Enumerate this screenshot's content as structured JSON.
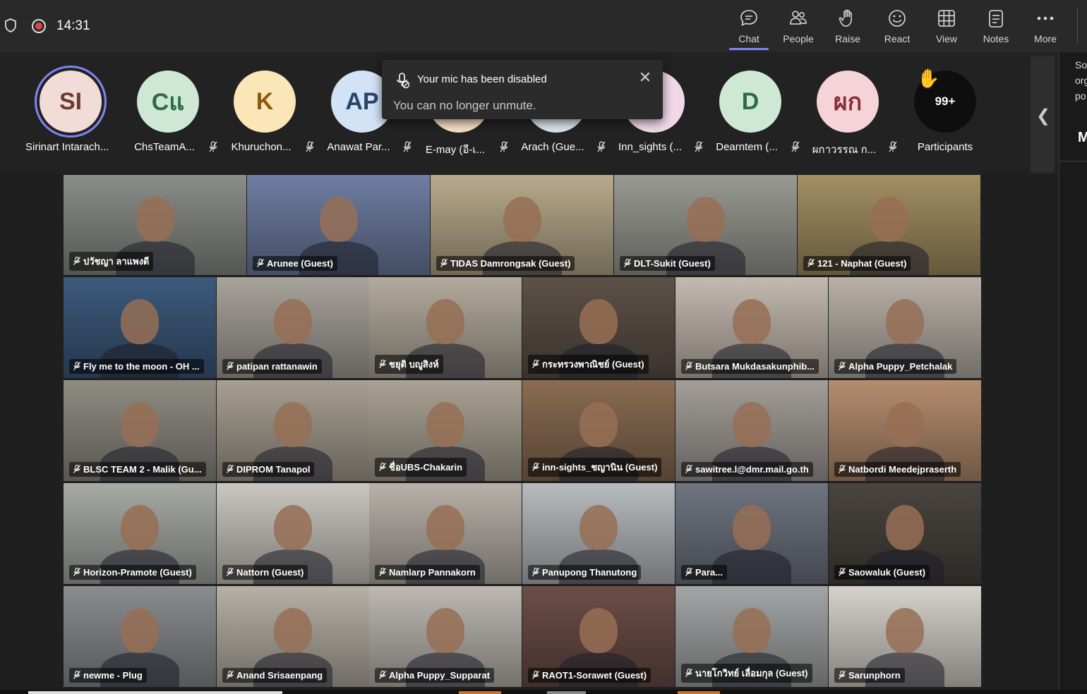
{
  "status": {
    "time": "14:31"
  },
  "toolbar": [
    {
      "key": "chat",
      "label": "Chat",
      "icon": "chat-icon"
    },
    {
      "key": "people",
      "label": "People",
      "icon": "people-icon"
    },
    {
      "key": "raise",
      "label": "Raise",
      "icon": "raise-hand-icon"
    },
    {
      "key": "react",
      "label": "React",
      "icon": "react-icon"
    },
    {
      "key": "view",
      "label": "View",
      "icon": "view-grid-icon"
    },
    {
      "key": "notes",
      "label": "Notes",
      "icon": "notes-icon"
    },
    {
      "key": "more",
      "label": "More",
      "icon": "more-icon"
    }
  ],
  "participants": [
    {
      "initials": "SI",
      "name": "Sirinart Intarach...",
      "bg": "#f1dcd8",
      "fg": "#6d3a33"
    },
    {
      "initials": "Cแ",
      "name": "ChsTeamA...",
      "bg": "#cfe8d6",
      "fg": "#2e6b45"
    },
    {
      "initials": "K",
      "name": "Khuruchon...",
      "bg": "#fbe6b8",
      "fg": "#8a5a10"
    },
    {
      "initials": "AP",
      "name": "Anawat Par...",
      "bg": "#d3e2f4",
      "fg": "#27456c"
    },
    {
      "initials": "",
      "name": "E-may (อี-เ...",
      "bg": "#f5dfc6",
      "fg": "#6d4a25"
    },
    {
      "initials": "",
      "name": "Arach (Gue...",
      "bg": "#d8e2ea",
      "fg": "#34495e"
    },
    {
      "initials": "",
      "name": "Inn_sights (...",
      "bg": "#f0d8e8",
      "fg": "#6a2f58"
    },
    {
      "initials": "D",
      "name": "Dearntem (...",
      "bg": "#cfe8d6",
      "fg": "#2e6b45"
    },
    {
      "initials": "ผก",
      "name": "ผกาวรรณ ก...",
      "bg": "#f6d3d8",
      "fg": "#8a2c3b"
    }
  ],
  "overflow": {
    "count": "99+",
    "label": "Participants"
  },
  "toast": {
    "title": "Your mic has been disabled",
    "message": "You can no longer unmute."
  },
  "right_panel": {
    "lines": [
      "So",
      "org",
      "po"
    ],
    "big": "M"
  },
  "tiles": [
    {
      "label": "ปวัชญา ลาแพงดี",
      "bg": "#8a8d88"
    },
    {
      "label": "Arunee (Guest)",
      "bg": "#6e7ea2"
    },
    {
      "label": "TIDAS Damrongsak (Guest)",
      "bg": "#b8aa8c"
    },
    {
      "label": "DLT-Sukit (Guest)",
      "bg": "#9a9a94"
    },
    {
      "label": "121 - Naphat (Guest)",
      "bg": "#a38f62"
    },
    {
      "label": "Fly me to the moon - OH ...",
      "bg": "#3c5a7c"
    },
    {
      "label": "patipan rattanawin",
      "bg": "#a8a39b"
    },
    {
      "label": "ชยุติ บญูสิงห์",
      "bg": "#b3ab9d"
    },
    {
      "label": "กระทรวงพาณิชย์ (Guest)",
      "bg": "#5d5148"
    },
    {
      "label": "Butsara Mukdasakunphib...",
      "bg": "#c4bab0"
    },
    {
      "label": "Alpha Puppy_Petchalak",
      "bg": "#b9b1a8"
    },
    {
      "label": "BLSC TEAM 2 - Malik (Gu...",
      "bg": "#8f8c83"
    },
    {
      "label": "DIPROM Tanapol",
      "bg": "#a79f92"
    },
    {
      "label": "ชื่อUBS-Chakarin",
      "bg": "#aaa394"
    },
    {
      "label": "inn-sights_ชญานิน (Guest)",
      "bg": "#8a6c52"
    },
    {
      "label": "sawitree.l@dmr.mail.go.th",
      "bg": "#a39e99"
    },
    {
      "label": "Natbordi Meedejpraserth",
      "bg": "#b58d6e"
    },
    {
      "label": "Horizon-Pramote (Guest)",
      "bg": "#a7aaa5"
    },
    {
      "label": "Nattorn (Guest)",
      "bg": "#c9c7c0"
    },
    {
      "label": "Namlarp Pannakorn",
      "bg": "#b7b1a8"
    },
    {
      "label": "Panupong Thanutong",
      "bg": "#b8bcbf"
    },
    {
      "label": "Para...",
      "bg": "#6f7480"
    },
    {
      "label": "Saowaluk (Guest)",
      "bg": "#49443f"
    },
    {
      "label": "newme - Plug",
      "bg": "#8a8d90"
    },
    {
      "label": "Anand Srisaenpang",
      "bg": "#b6b0a5"
    },
    {
      "label": "Alpha Puppy_Supparat",
      "bg": "#bdb8b2"
    },
    {
      "label": "RAOT1-Sorawet (Guest)",
      "bg": "#6c4d47"
    },
    {
      "label": "นายโกวิทย์ เลื่อมกุล (Guest)",
      "bg": "#a3a6a6"
    },
    {
      "label": "Sarunphorn",
      "bg": "#d6d2cb"
    }
  ]
}
